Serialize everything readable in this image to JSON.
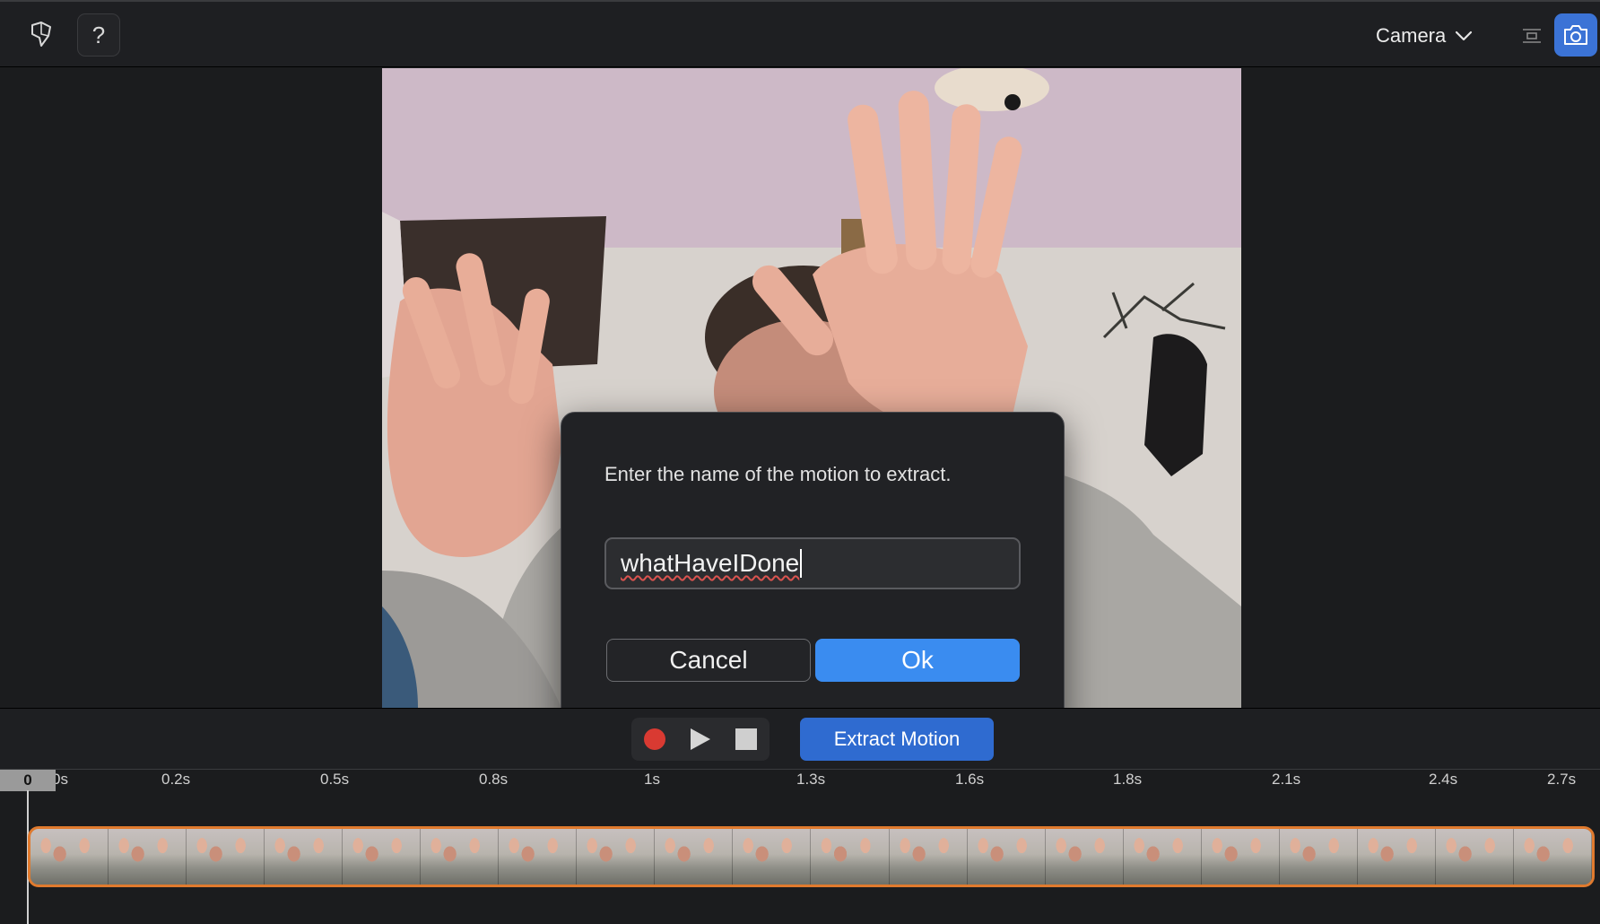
{
  "toolbar": {
    "help_label": "?",
    "camera_select": {
      "value": "Camera"
    },
    "icons": {
      "logo": "app-logo-icon",
      "help": "help-icon",
      "dropdown": "chevron-down-icon",
      "list": "list-icon",
      "snapshot": "camera-icon"
    }
  },
  "dialog": {
    "message": "Enter the name of the motion to extract.",
    "input_value": "whatHaveIDone",
    "cancel_label": "Cancel",
    "ok_label": "Ok"
  },
  "transport": {
    "record_icon": "record-icon",
    "play_icon": "play-icon",
    "stop_icon": "stop-icon",
    "extract_label": "Extract Motion"
  },
  "timeline": {
    "playhead_label": "0",
    "ticks": [
      "0s",
      "0.2s",
      "0.5s",
      "0.8s",
      "1s",
      "1.3s",
      "1.6s",
      "1.8s",
      "2.1s",
      "2.4s",
      "2.7s"
    ],
    "frame_count": 20
  },
  "colors": {
    "accent": "#3a8cf0",
    "extract_button": "#2f6bd0",
    "record": "#d93a32",
    "strip_border": "#e07a2e"
  }
}
